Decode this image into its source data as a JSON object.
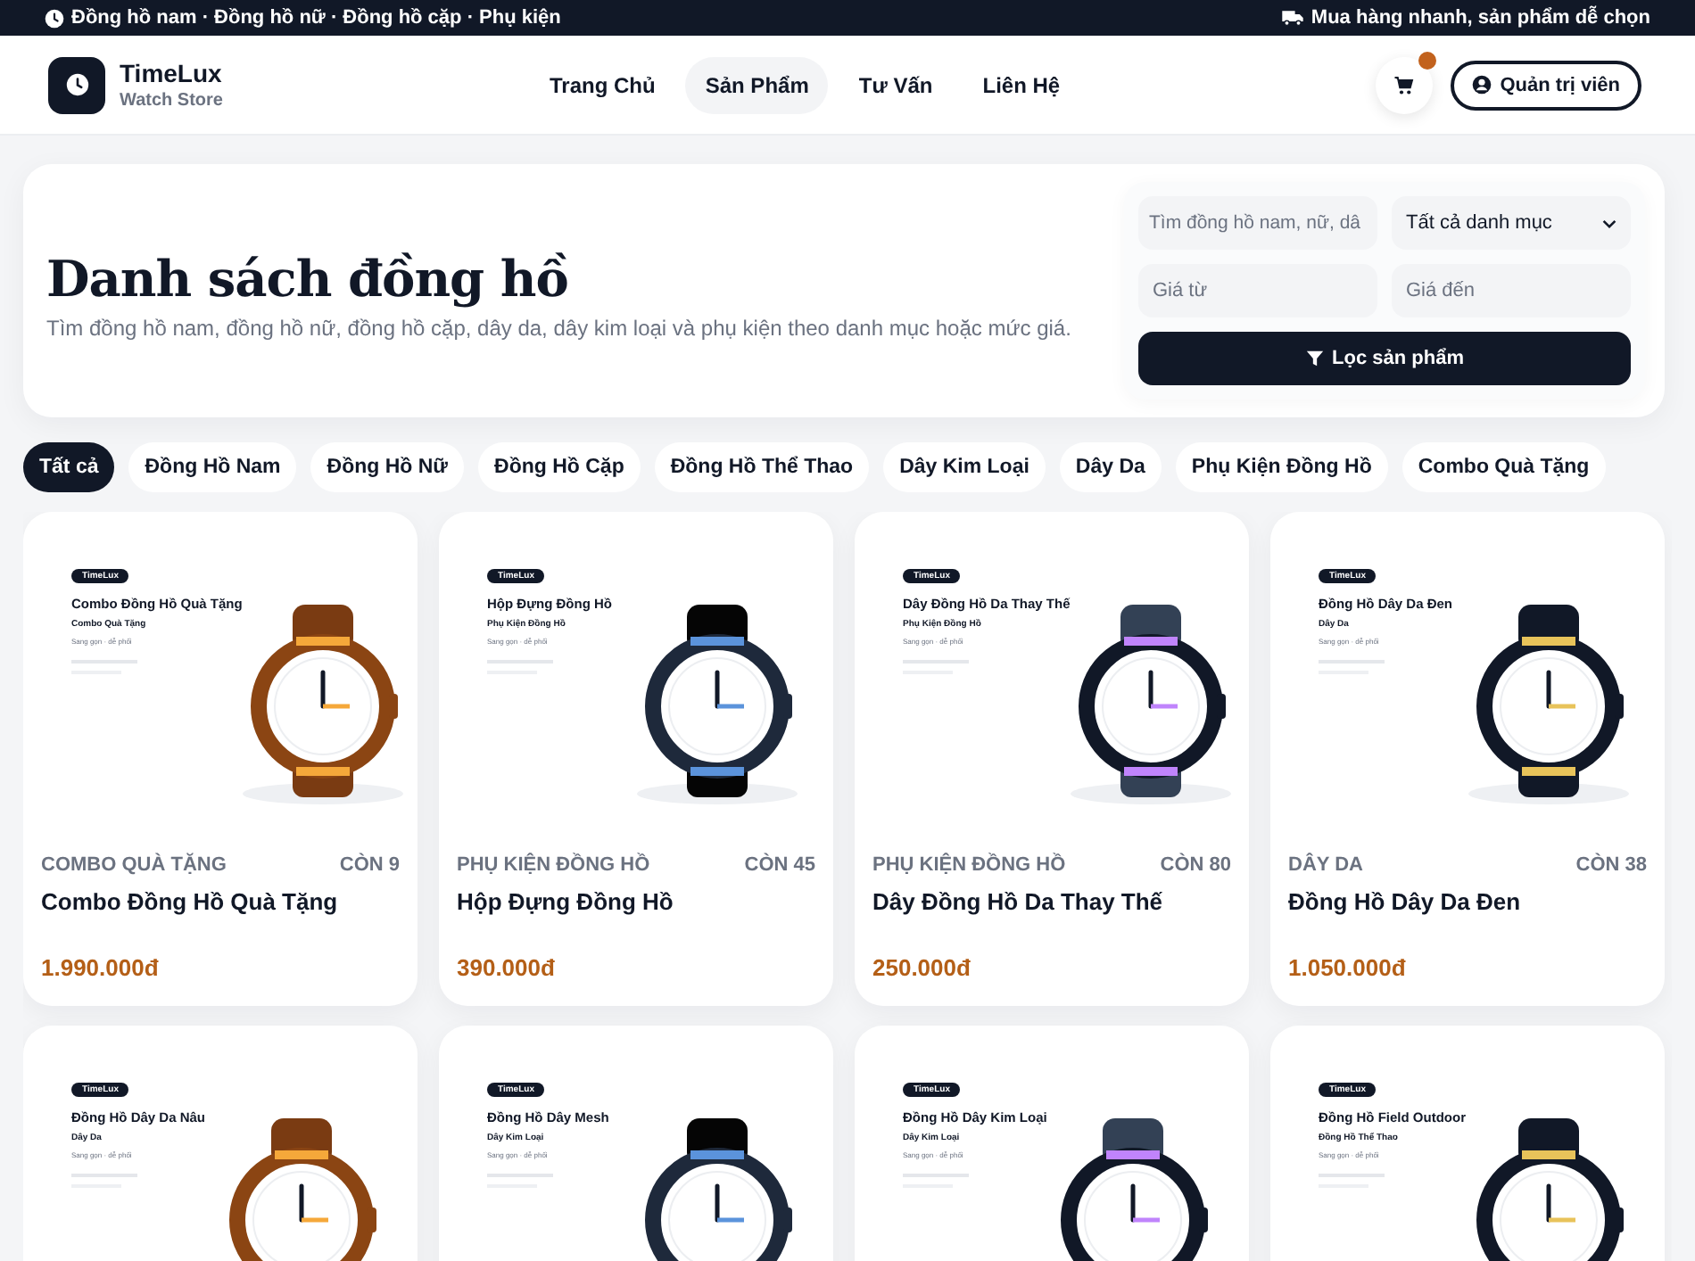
{
  "top_bar": {
    "left_text": "Đồng hồ nam · Đồng hồ nữ · Đồng hồ cặp · Phụ kiện",
    "right_text": "Mua hàng nhanh, sản phẩm dễ chọn"
  },
  "header": {
    "brand": "TimeLux",
    "tagline": "Watch Store",
    "nav": [
      {
        "label": "Trang Chủ",
        "selected": false
      },
      {
        "label": "Sản Phẩm",
        "selected": true
      },
      {
        "label": "Tư Vấn",
        "selected": false
      },
      {
        "label": "Liên Hệ",
        "selected": false
      }
    ],
    "admin_button": "Quản trị viên"
  },
  "hero": {
    "title": "Danh sách đồng hồ",
    "subtitle": "Tìm đồng hồ nam, đồng hồ nữ, đồng hồ cặp, dây da, dây kim loại và phụ kiện theo danh mục hoặc mức giá.",
    "filter": {
      "search_placeholder": "Tìm đồng hồ nam, nữ, dâ",
      "category_value": "Tất cả danh mục",
      "price_from_placeholder": "Giá từ",
      "price_to_placeholder": "Giá đến",
      "button": "Lọc sản phẩm"
    }
  },
  "categories": [
    {
      "label": "Tất cả",
      "selected": true
    },
    {
      "label": "Đồng Hồ Nam",
      "selected": false
    },
    {
      "label": "Đồng Hồ Nữ",
      "selected": false
    },
    {
      "label": "Đồng Hồ Cặp",
      "selected": false
    },
    {
      "label": "Đồng Hồ Thể Thao",
      "selected": false
    },
    {
      "label": "Dây Kim Loại",
      "selected": false
    },
    {
      "label": "Dây Da",
      "selected": false
    },
    {
      "label": "Phụ Kiện Đồng Hồ",
      "selected": false
    },
    {
      "label": "Combo Quà Tặng",
      "selected": false
    }
  ],
  "products": [
    {
      "image": {
        "badge": "TimeLux",
        "title": "Combo Đồng Hồ Quà Tặng",
        "subtitle": "Combo Quà Tặng",
        "note": "Sang gọn · dễ phối"
      },
      "watch_parts": [
        {
          "kind": "strap",
          "color": "#7a3b12"
        },
        {
          "kind": "accent",
          "color": "#f5a83a"
        },
        {
          "kind": "case",
          "color": "#8b4513"
        }
      ],
      "category": "COMBO QUÀ TẶNG",
      "stock": "CÒN 9",
      "name": "Combo Đồng Hồ Quà Tặng",
      "price": "1.990.000đ"
    },
    {
      "image": {
        "badge": "TimeLux",
        "title": "Hộp Đựng Đồng Hồ",
        "subtitle": "Phụ Kiện Đồng Hồ",
        "note": "Sang gọn · dễ phối"
      },
      "watch_parts": [
        {
          "kind": "strap",
          "color": "#050505"
        },
        {
          "kind": "accent",
          "color": "#5b93db"
        },
        {
          "kind": "case",
          "color": "#1e293b"
        }
      ],
      "category": "PHỤ KIỆN ĐỒNG HỒ",
      "stock": "CÒN 45",
      "name": "Hộp Đựng Đồng Hồ",
      "price": "390.000đ"
    },
    {
      "image": {
        "badge": "TimeLux",
        "title": "Dây Đồng Hồ Da Thay Thế",
        "subtitle": "Phụ Kiện Đồng Hồ",
        "note": "Sang gọn · dễ phối"
      },
      "watch_parts": [
        {
          "kind": "strap",
          "color": "#334155"
        },
        {
          "kind": "accent",
          "color": "#c084fc"
        },
        {
          "kind": "case",
          "color": "#111827"
        }
      ],
      "category": "PHỤ KIỆN ĐỒNG HỒ",
      "stock": "CÒN 80",
      "name": "Dây Đồng Hồ Da Thay Thế",
      "price": "250.000đ"
    },
    {
      "image": {
        "badge": "TimeLux",
        "title": "Đồng Hồ Dây Da Đen",
        "subtitle": "Dây Da",
        "note": "Sang gọn · dễ phối"
      },
      "watch_parts": [
        {
          "kind": "strap",
          "color": "#111827"
        },
        {
          "kind": "accent",
          "color": "#e8c35a"
        },
        {
          "kind": "case",
          "color": "#111827"
        }
      ],
      "category": "DÂY DA",
      "stock": "CÒN 38",
      "name": "Đồng Hồ Dây Da Đen",
      "price": "1.050.000đ"
    },
    {
      "image": {
        "badge": "TimeLux",
        "title": "Đồng Hồ Dây Da Nâu",
        "subtitle": "Dây Da",
        "note": "Sang gọn · dễ phối"
      },
      "watch_parts": [
        {
          "kind": "strap",
          "color": "#7a3b12"
        },
        {
          "kind": "accent",
          "color": "#f5a83a"
        },
        {
          "kind": "case",
          "color": "#8b4513"
        }
      ]
    },
    {
      "image": {
        "badge": "TimeLux",
        "title": "Đồng Hồ Dây Mesh",
        "subtitle": "Dây Kim Loại",
        "note": "Sang gọn · dễ phối"
      },
      "watch_parts": [
        {
          "kind": "strap",
          "color": "#050505"
        },
        {
          "kind": "accent",
          "color": "#5b93db"
        },
        {
          "kind": "case",
          "color": "#1e293b"
        }
      ]
    },
    {
      "image": {
        "badge": "TimeLux",
        "title": "Đồng Hồ Dây Kim Loại",
        "subtitle": "Dây Kim Loại",
        "note": "Sang gọn · dễ phối"
      },
      "watch_parts": [
        {
          "kind": "strap",
          "color": "#334155"
        },
        {
          "kind": "accent",
          "color": "#c084fc"
        },
        {
          "kind": "case",
          "color": "#111827"
        }
      ]
    },
    {
      "image": {
        "badge": "TimeLux",
        "title": "Đồng Hồ Field Outdoor",
        "subtitle": "Đồng Hồ Thể Thao",
        "note": "Sang gọn · dễ phối"
      },
      "watch_parts": [
        {
          "kind": "strap",
          "color": "#111827"
        },
        {
          "kind": "accent",
          "color": "#e8c35a"
        },
        {
          "kind": "case",
          "color": "#111827"
        }
      ]
    }
  ]
}
